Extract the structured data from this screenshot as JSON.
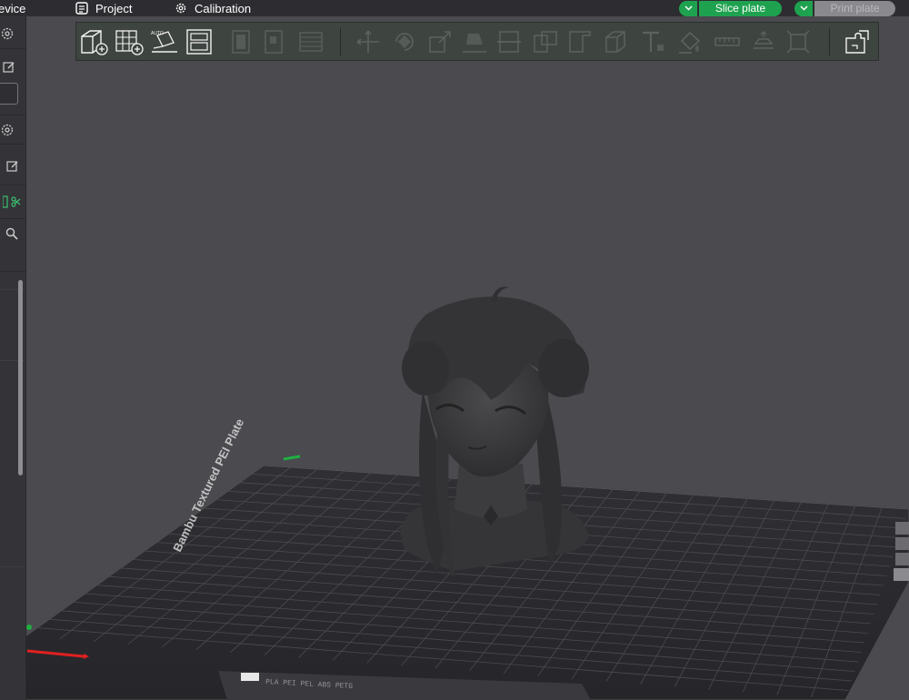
{
  "topbar": {
    "device_label": "evice",
    "project_label": "Project",
    "calibration_label": "Calibration",
    "slice_label": "Slice plate",
    "print_label": "Print plate"
  },
  "icons": {
    "project": "list-document-icon",
    "calibration": "gear-icon",
    "dropdown": "chevron-down-icon",
    "toolbar": [
      "add-cube-icon",
      "add-plate-icon",
      "auto-orient-icon",
      "arrange-layout-icon",
      "disabled-object-icon",
      "disabled-plate-icon",
      "disabled-grid-icon",
      "move-icon",
      "rotate-icon",
      "scale-icon",
      "lay-on-face-icon",
      "cut-icon",
      "mesh-boolean-icon",
      "support-paint-icon",
      "seam-paint-icon",
      "color-paint-icon",
      "text-icon",
      "emboss-icon",
      "measure-icon",
      "assembly-icon",
      "variable-layer-icon",
      "split-parts-icon"
    ]
  },
  "sidebar": {
    "icons": [
      "gear-icon",
      "edit-icon",
      "gear-icon",
      "edit-icon",
      "list-icon",
      "scissors-icon",
      "search-icon"
    ]
  },
  "plate": {
    "label": "Bambu Textured PEI Plate",
    "tag": "PLA  PEI  PEL  ABS  PETG"
  },
  "colors": {
    "accent_green": "#1fa24f",
    "background": "#4a4a4f",
    "plate": "#2c2c30",
    "model": "#3b3b3d"
  }
}
